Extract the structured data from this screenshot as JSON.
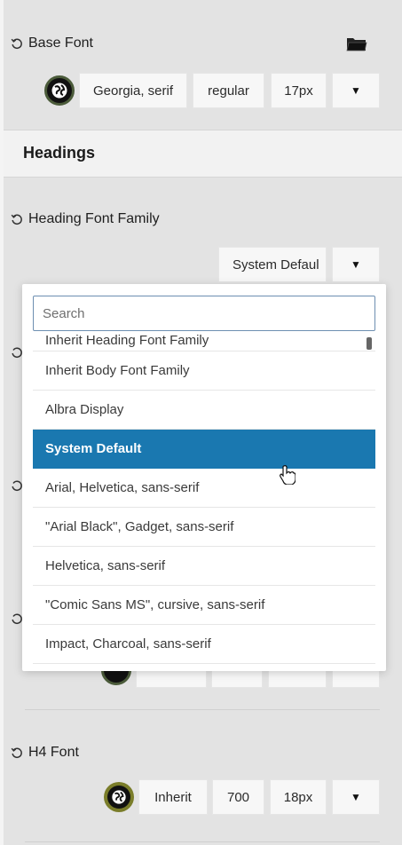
{
  "base_font": {
    "label": "Base Font",
    "family": "Georgia, serif",
    "weight": "regular",
    "size": "17px"
  },
  "headings_section": {
    "title": "Headings"
  },
  "heading_font_family": {
    "label": "Heading Font Family",
    "value": "System Defaul"
  },
  "dropdown": {
    "search_placeholder": "Search",
    "options": [
      "Inherit Heading Font Family",
      "Inherit Body Font Family",
      "Albra Display",
      "System Default",
      "Arial, Helvetica, sans-serif",
      "\"Arial Black\", Gadget, sans-serif",
      "Helvetica, sans-serif",
      "\"Comic Sans MS\", cursive, sans-serif",
      "Impact, Charcoal, sans-serif"
    ],
    "selected": "System Default"
  },
  "h4_font": {
    "label": "H4 Font",
    "family": "Inherit",
    "weight": "700",
    "size": "18px"
  },
  "colors": {
    "selected_bg": "#1a78b0",
    "panel_bg": "#e3e3e3",
    "section_bg": "#f2f2f2",
    "globe_olive": "#7a7d2a"
  },
  "icons": {
    "reset": "reset-icon",
    "folder": "folder-icon",
    "globe": "globe-icon",
    "caret": "caret-down-icon",
    "cursor": "hand-cursor-icon"
  }
}
